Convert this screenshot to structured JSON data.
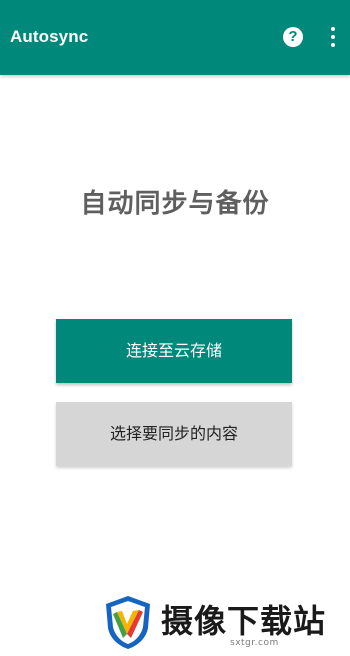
{
  "app_bar": {
    "title": "Autosync",
    "help_glyph": "?",
    "background_color": "#00897b",
    "icons": [
      "help-circle-icon",
      "overflow-menu-icon"
    ]
  },
  "main": {
    "headline": "自动同步与备份",
    "connect_button_label": "连接至云存储",
    "choose_button_label": "选择要同步的内容"
  },
  "colors": {
    "accent": "#00897b",
    "secondary_button": "#d6d6d6",
    "headline_text": "#5f5f5f"
  },
  "watermark": {
    "brand_text": "摄像下载站",
    "domain_text": "sxtgr.com",
    "logo_icon": "shield-logo-icon"
  }
}
